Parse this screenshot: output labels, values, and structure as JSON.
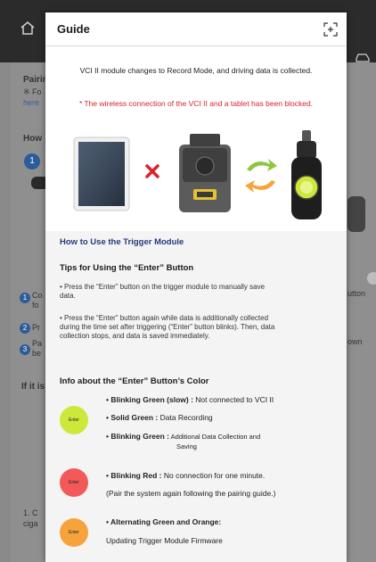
{
  "background": {
    "pairing_label": "Pairin",
    "pairing_sub": "※ Fo",
    "pairing_link": "here",
    "how_label": "How",
    "step1_num": "1",
    "side_left": [
      {
        "num": "1",
        "label": "Co",
        "sub": "fo"
      },
      {
        "num": "2",
        "label": "Pr"
      },
      {
        "num": "3",
        "label": "Pa",
        "sub": "be"
      }
    ],
    "side_right": [
      "utton",
      "own"
    ],
    "if_label": "If it is",
    "footnote_1": "1. C",
    "footnote_2": "ciga"
  },
  "modal": {
    "title": "Guide",
    "intro": "VCI II module changes to Record Mode, and driving data is collected.",
    "warning": "* The wireless connection of the VCI II and a tablet has been blocked.",
    "section_title": "How to Use the Trigger Module",
    "tips_heading": "Tips for Using the “Enter” Button",
    "tips": [
      [
        "•  Press the “Enter” button on the trigger module to manually save",
        "data."
      ],
      [
        "•  Press the “Enter” button again while data is additionally collected",
        "during the time set after triggering (“Enter” button blinks). Then, data",
        "collection stops, and data is saved immediately."
      ]
    ],
    "info_heading": "Info about the “Enter” Button’s Color",
    "enter_label": "Enter",
    "colors": {
      "green": "#cde83a",
      "red": "#f25a5a",
      "orange": "#f6a33b",
      "accent_blue": "#243b7a",
      "warning_red": "#d9232d"
    },
    "green_items": [
      {
        "term": "•  Blinking Green (slow) :",
        "desc": " Not connected to VCI II"
      },
      {
        "term": "•  Solid Green :",
        "desc": " Data Recording"
      },
      {
        "term": "•  Blinking Green :",
        "desc": " Additional Data Collection and",
        "desc2": "Saving"
      }
    ],
    "red_item": {
      "term": "•  Blinking Red :",
      "desc": " No connection for one minute.",
      "note": "(Pair the system again following the pairing guide.)"
    },
    "orange_item": {
      "term": "•  Alternating Green and Orange:",
      "desc": "Updating Trigger Module Firmware"
    }
  }
}
